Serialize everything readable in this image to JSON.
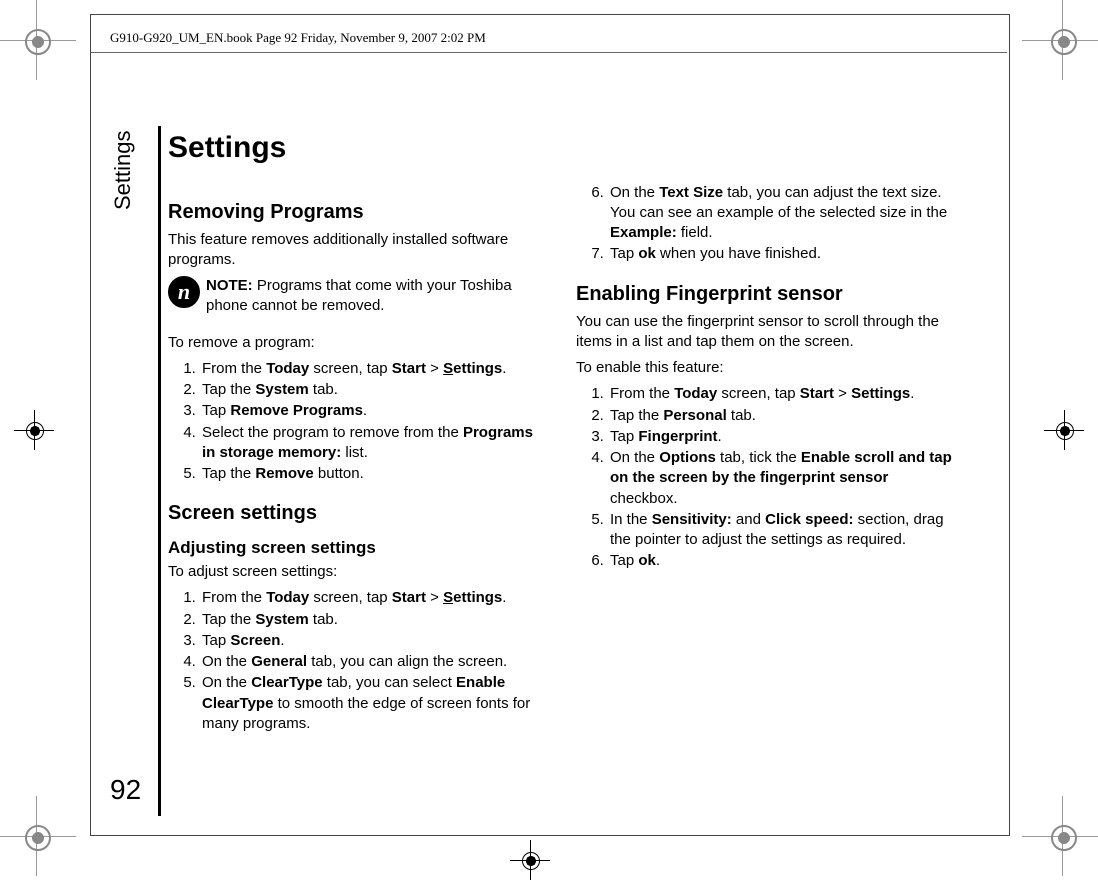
{
  "running_head": "G910-G920_UM_EN.book  Page 92  Friday, November 9, 2007  2:02 PM",
  "side_label": "Settings",
  "page_number": "92",
  "title": "Settings",
  "sec1": {
    "heading": "Removing Programs",
    "intro": "This feature removes additionally installed software programs.",
    "note_label": "NOTE:",
    "note_text": " Programs that come with your Toshiba phone cannot be removed.",
    "lead": "To remove a program:",
    "steps": {
      "s1a": "From the ",
      "s1b": "Today",
      "s1c": " screen, tap ",
      "s1d": "Start",
      "s1e": " > ",
      "s1f": "S",
      "s1g": "ettings",
      "s1h": ".",
      "s2a": "Tap the ",
      "s2b": "System",
      "s2c": " tab.",
      "s3a": "Tap ",
      "s3b": "Remove Programs",
      "s3c": ".",
      "s4a": "Select the program to remove from the ",
      "s4b": "Programs in storage memory:",
      "s4c": " list.",
      "s5a": "Tap the ",
      "s5b": "Remove",
      "s5c": " button."
    }
  },
  "sec2": {
    "heading": "Screen settings",
    "sub": "Adjusting screen settings",
    "lead": "To adjust screen settings:",
    "steps": {
      "s1a": "From the ",
      "s1b": "Today",
      "s1c": " screen, tap ",
      "s1d": "Start",
      "s1e": " > ",
      "s1f": "S",
      "s1g": "ettings",
      "s1h": ".",
      "s2a": "Tap the ",
      "s2b": "System",
      "s2c": " tab.",
      "s3a": "Tap ",
      "s3b": "Screen",
      "s3c": ".",
      "s4a": "On the ",
      "s4b": "General",
      "s4c": " tab, you can align the screen.",
      "s5a": "On the ",
      "s5b": "ClearType",
      "s5c": " tab, you can select ",
      "s5d": "Enable ClearType",
      "s5e": " to smooth the edge of screen fonts for many programs.",
      "s6a": "On the ",
      "s6b": "Text Size",
      "s6c": " tab, you can adjust the text size. You can see an example of the selected size in the ",
      "s6d": "Example:",
      "s6e": " field.",
      "s7a": "Tap ",
      "s7b": "ok",
      "s7c": " when you have finished."
    }
  },
  "sec3": {
    "heading": "Enabling Fingerprint sensor",
    "p1": "You can use the fingerprint sensor to scroll through the items in a list and tap them on the screen.",
    "lead": "To enable this feature:",
    "steps": {
      "s1a": "From the ",
      "s1b": "Today",
      "s1c": " screen, tap ",
      "s1d": "Start",
      "s1e": " > ",
      "s1f": "Settings",
      "s1g": ".",
      "s2a": "Tap the ",
      "s2b": "Personal",
      "s2c": " tab.",
      "s3a": "Tap ",
      "s3b": "Fingerprint",
      "s3c": ".",
      "s4a": "On the ",
      "s4b": "Options",
      "s4c": " tab, tick the ",
      "s4d": "Enable scroll and tap on the screen by the fingerprint sensor",
      "s4e": " checkbox.",
      "s5a": "In the ",
      "s5b": "Sensitivity:",
      "s5c": " and ",
      "s5d": "Click speed:",
      "s5e": " section, drag the pointer to adjust the settings as required.",
      "s6a": "Tap ",
      "s6b": "ok",
      "s6c": "."
    }
  }
}
